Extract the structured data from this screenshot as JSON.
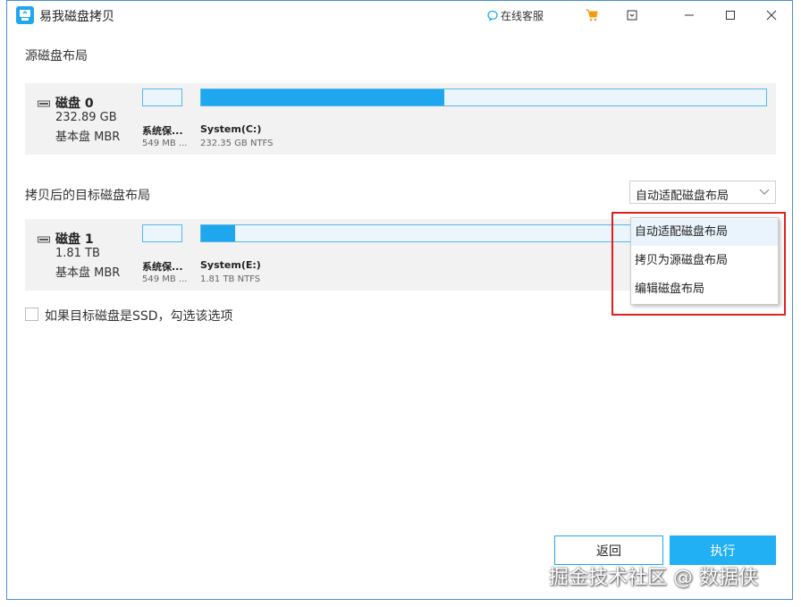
{
  "window": {
    "title": "易我磁盘拷贝",
    "support_label": "在线客服"
  },
  "source": {
    "section_title": "源磁盘布局",
    "disk": {
      "name": "磁盘 0",
      "size": "232.89 GB",
      "type": "基本盘 MBR"
    },
    "partitions": [
      {
        "label": "系统保...",
        "sub": "549 MB ..."
      },
      {
        "label": "System(C:)",
        "sub": "232.35 GB NTFS",
        "used_fraction": 0.43
      }
    ]
  },
  "target": {
    "section_title": "拷贝后的目标磁盘布局",
    "disk": {
      "name": "磁盘 1",
      "size": "1.81 TB",
      "type": "基本盘 MBR"
    },
    "partitions": [
      {
        "label": "系统保...",
        "sub": "549 MB ..."
      },
      {
        "label": "System(E:)",
        "sub": "1.81 TB NTFS",
        "used_fraction": 0.06
      }
    ]
  },
  "layout_select": {
    "value": "自动适配磁盘布局",
    "options": [
      "自动适配磁盘布局",
      "拷贝为源磁盘布局",
      "编辑磁盘布局"
    ]
  },
  "ssd_option": {
    "label": "如果目标磁盘是SSD，勾选该选项",
    "checked": false
  },
  "buttons": {
    "back": "返回",
    "execute": "执行"
  },
  "watermark": "掘金技术社区 @ 数据侠",
  "colors": {
    "accent": "#1ea7ee",
    "highlight": "#e02020",
    "panel": "#f2f2f2"
  }
}
